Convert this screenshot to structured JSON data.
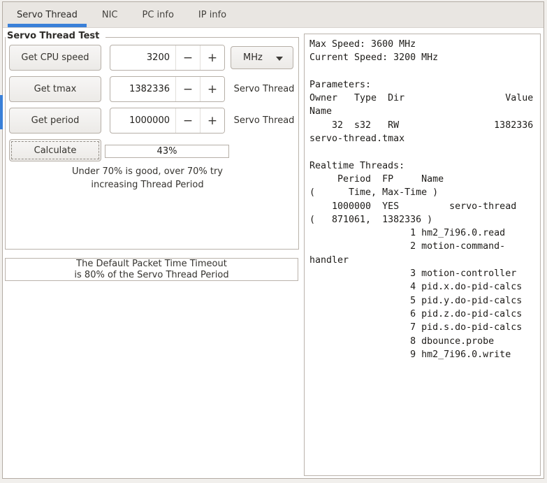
{
  "colors": {
    "accent": "#3a80d8",
    "header_bg": "#e9e6e2",
    "border": "#b6afa7",
    "border_dark": "#b3aca4",
    "frame_border": "#bab3ab",
    "text": "#35332f"
  },
  "tabs": [
    {
      "label": "Servo Thread",
      "active": true
    },
    {
      "label": "NIC",
      "active": false
    },
    {
      "label": "PC info",
      "active": false
    },
    {
      "label": "IP info",
      "active": false
    }
  ],
  "icons": {
    "minus": "−",
    "plus": "+"
  },
  "servo_test": {
    "frame_title": "Servo Thread Test",
    "rows": [
      {
        "button": "Get CPU speed",
        "value": "3200",
        "unit": "MHz"
      },
      {
        "button": "Get tmax",
        "value": "1382336",
        "thread_label": "Servo Thread"
      },
      {
        "button": "Get period",
        "value": "1000000",
        "thread_label": "Servo Thread"
      }
    ],
    "calculate_button": "Calculate",
    "load_percent": "43%",
    "hint_line1": "Under 70% is good, over 70% try",
    "hint_line2": "increasing Thread Period"
  },
  "packet_frame": {
    "line1": "The Default Packet Time Timeout",
    "line2": "is 80% of the Servo Thread Period"
  },
  "output": {
    "lines": [
      "Max Speed: 3600 MHz",
      "Current Speed: 3200 MHz",
      "",
      "Parameters:",
      "Owner   Type  Dir                  Value",
      "Name",
      "    32  s32   RW                 1382336",
      "servo-thread.tmax",
      "",
      "Realtime Threads:",
      "     Period  FP     Name",
      "(      Time, Max-Time )",
      "    1000000  YES         servo-thread",
      "(   871061,  1382336 )",
      "                  1 hm2_7i96.0.read",
      "                  2 motion-command-",
      "handler",
      "                  3 motion-controller",
      "                  4 pid.x.do-pid-calcs",
      "                  5 pid.y.do-pid-calcs",
      "                  6 pid.z.do-pid-calcs",
      "                  7 pid.s.do-pid-calcs",
      "                  8 dbounce.probe",
      "                  9 hm2_7i96.0.write"
    ]
  }
}
